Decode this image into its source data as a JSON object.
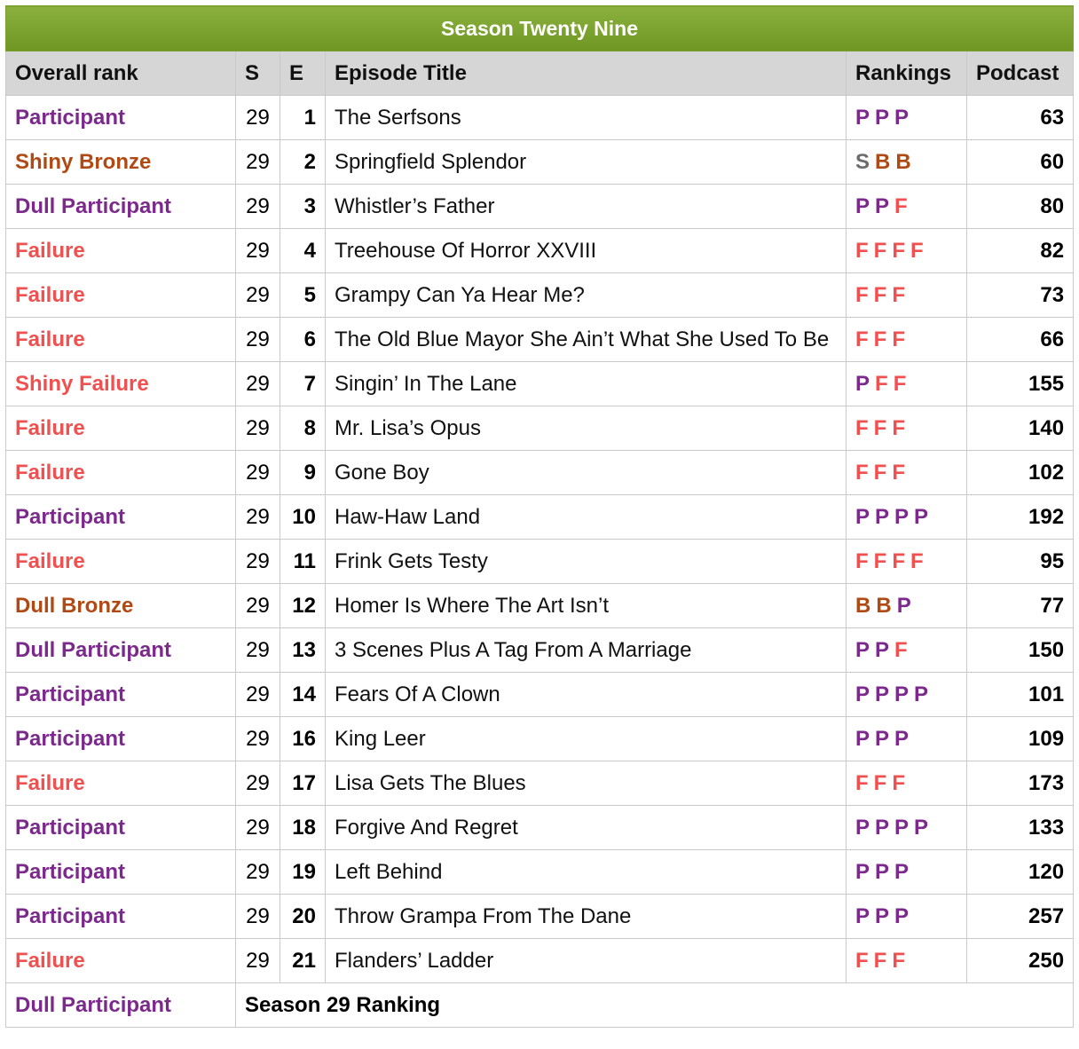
{
  "title": "Season Twenty Nine",
  "headers": [
    "Overall rank",
    "S",
    "E",
    "Episode Title",
    "Rankings",
    "Podcast"
  ],
  "colors": {
    "P": "#7b2a8c",
    "B": "#b04a14",
    "S": "#6c6c6c",
    "F": "#f0504f"
  },
  "rows": [
    {
      "rank": "Participant",
      "rank_color": "P",
      "s": "29",
      "e": "1",
      "title": "The Serfsons",
      "rankings": [
        "P",
        "P",
        "P"
      ],
      "podcast": "63"
    },
    {
      "rank": "Shiny Bronze",
      "rank_color": "B",
      "s": "29",
      "e": "2",
      "title": "Springfield Splendor",
      "rankings": [
        "S",
        "B",
        "B"
      ],
      "podcast": "60"
    },
    {
      "rank": "Dull Participant",
      "rank_color": "P",
      "s": "29",
      "e": "3",
      "title": "Whistler’s Father",
      "rankings": [
        "P",
        "P",
        "F"
      ],
      "podcast": "80"
    },
    {
      "rank": "Failure",
      "rank_color": "F",
      "s": "29",
      "e": "4",
      "title": "Treehouse Of Horror XXVIII",
      "rankings": [
        "F",
        "F",
        "F",
        "F"
      ],
      "podcast": "82"
    },
    {
      "rank": "Failure",
      "rank_color": "F",
      "s": "29",
      "e": "5",
      "title": "Grampy Can Ya Hear Me?",
      "rankings": [
        "F",
        "F",
        "F"
      ],
      "podcast": "73"
    },
    {
      "rank": "Failure",
      "rank_color": "F",
      "s": "29",
      "e": "6",
      "title": "The Old Blue Mayor She Ain’t What She Used To Be",
      "rankings": [
        "F",
        "F",
        "F"
      ],
      "podcast": "66"
    },
    {
      "rank": "Shiny Failure",
      "rank_color": "F",
      "s": "29",
      "e": "7",
      "title": "Singin’ In The Lane",
      "rankings": [
        "P",
        "F",
        "F"
      ],
      "podcast": "155"
    },
    {
      "rank": "Failure",
      "rank_color": "F",
      "s": "29",
      "e": "8",
      "title": "Mr. Lisa’s Opus",
      "rankings": [
        "F",
        "F",
        "F"
      ],
      "podcast": "140"
    },
    {
      "rank": "Failure",
      "rank_color": "F",
      "s": "29",
      "e": "9",
      "title": "Gone Boy",
      "rankings": [
        "F",
        "F",
        "F"
      ],
      "podcast": "102"
    },
    {
      "rank": "Participant",
      "rank_color": "P",
      "s": "29",
      "e": "10",
      "title": "Haw-Haw Land",
      "rankings": [
        "P",
        "P",
        "P",
        "P"
      ],
      "podcast": "192"
    },
    {
      "rank": "Failure",
      "rank_color": "F",
      "s": "29",
      "e": "11",
      "title": "Frink Gets Testy",
      "rankings": [
        "F",
        "F",
        "F",
        "F"
      ],
      "podcast": "95"
    },
    {
      "rank": "Dull Bronze",
      "rank_color": "B",
      "s": "29",
      "e": "12",
      "title": "Homer Is Where The Art Isn’t",
      "rankings": [
        "B",
        "B",
        "P"
      ],
      "podcast": "77"
    },
    {
      "rank": "Dull Participant",
      "rank_color": "P",
      "s": "29",
      "e": "13",
      "title": "3 Scenes Plus A Tag From A Marriage",
      "rankings": [
        "P",
        "P",
        "F"
      ],
      "podcast": "150"
    },
    {
      "rank": "Participant",
      "rank_color": "P",
      "s": "29",
      "e": "14",
      "title": "Fears Of A Clown",
      "rankings": [
        "P",
        "P",
        "P",
        "P"
      ],
      "podcast": "101"
    },
    {
      "rank": "Participant",
      "rank_color": "P",
      "s": "29",
      "e": "16",
      "title": "King Leer",
      "rankings": [
        "P",
        "P",
        "P"
      ],
      "podcast": "109"
    },
    {
      "rank": "Failure",
      "rank_color": "F",
      "s": "29",
      "e": "17",
      "title": "Lisa Gets The Blues",
      "rankings": [
        "F",
        "F",
        "F"
      ],
      "podcast": "173"
    },
    {
      "rank": "Participant",
      "rank_color": "P",
      "s": "29",
      "e": "18",
      "title": "Forgive And Regret",
      "rankings": [
        "P",
        "P",
        "P",
        "P"
      ],
      "podcast": "133"
    },
    {
      "rank": "Participant",
      "rank_color": "P",
      "s": "29",
      "e": "19",
      "title": "Left Behind",
      "rankings": [
        "P",
        "P",
        "P"
      ],
      "podcast": "120"
    },
    {
      "rank": "Participant",
      "rank_color": "P",
      "s": "29",
      "e": "20",
      "title": "Throw Grampa From The Dane",
      "rankings": [
        "P",
        "P",
        "P"
      ],
      "podcast": "257"
    },
    {
      "rank": "Failure",
      "rank_color": "F",
      "s": "29",
      "e": "21",
      "title": "Flanders’ Ladder",
      "rankings": [
        "F",
        "F",
        "F"
      ],
      "podcast": "250"
    }
  ],
  "summary": {
    "rank": "Dull Participant",
    "rank_color": "P",
    "label": "Season 29 Ranking"
  }
}
